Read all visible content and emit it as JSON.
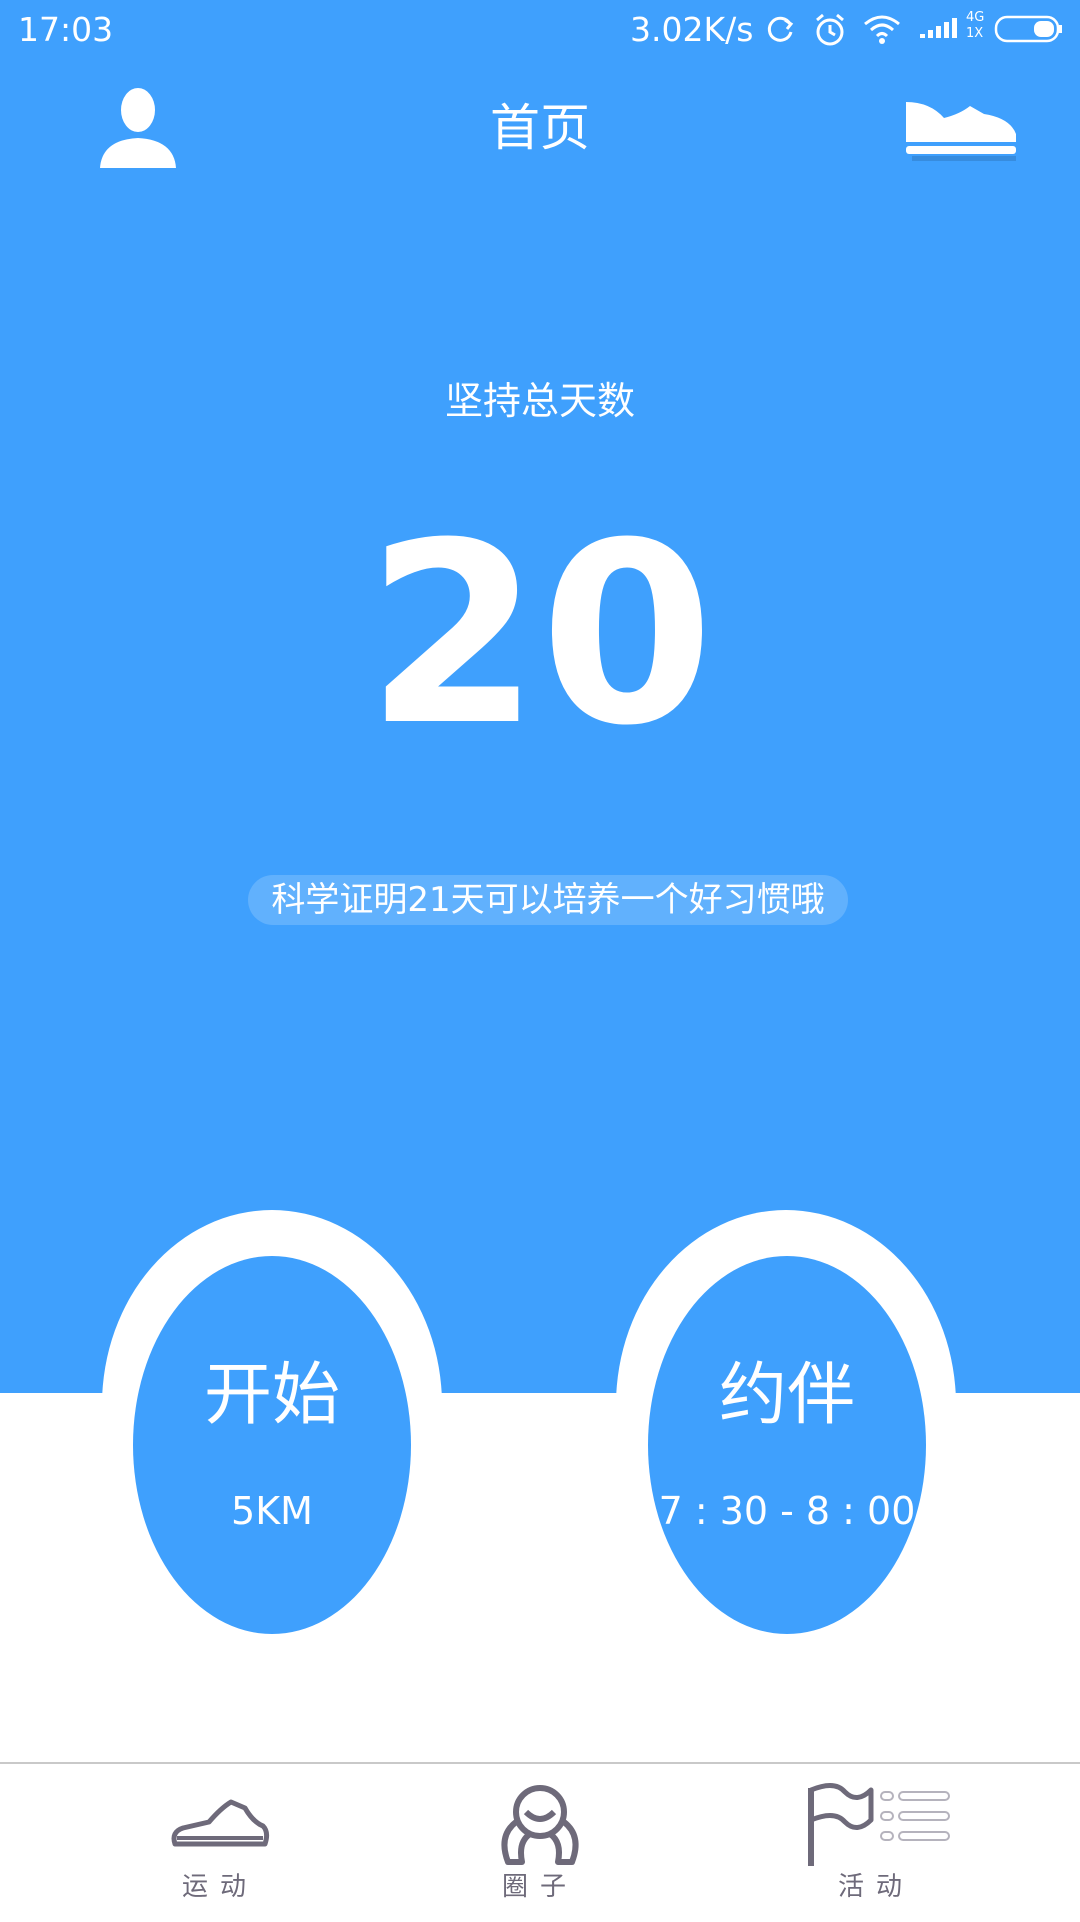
{
  "status_bar": {
    "time": "17:03",
    "network_speed": "3.02K/s",
    "icons": [
      "sync-icon",
      "alarm-icon",
      "wifi-icon",
      "signal-icon",
      "battery-icon"
    ],
    "signal_text_top": "4G",
    "signal_text_bottom": "1X"
  },
  "header": {
    "title": "首页",
    "left_icon": "profile-icon",
    "right_icon": "shoe-icon"
  },
  "stats": {
    "label": "坚持总天数",
    "value": "20",
    "tip": "科学证明21天可以培养一个好习惯哦"
  },
  "actions": [
    {
      "title": "开始",
      "subtitle": "5KM"
    },
    {
      "title": "约伴",
      "subtitle": "7 : 30 - 8 : 00"
    }
  ],
  "bottom_nav": [
    {
      "label": "运动",
      "icon": "sneaker-icon"
    },
    {
      "label": "圈子",
      "icon": "circle-group-icon"
    },
    {
      "label": "活动",
      "icon": "flag-icon"
    }
  ],
  "colors": {
    "primary": "#3fa0fd",
    "nav_text": "#6e6a7a",
    "white": "#ffffff"
  }
}
